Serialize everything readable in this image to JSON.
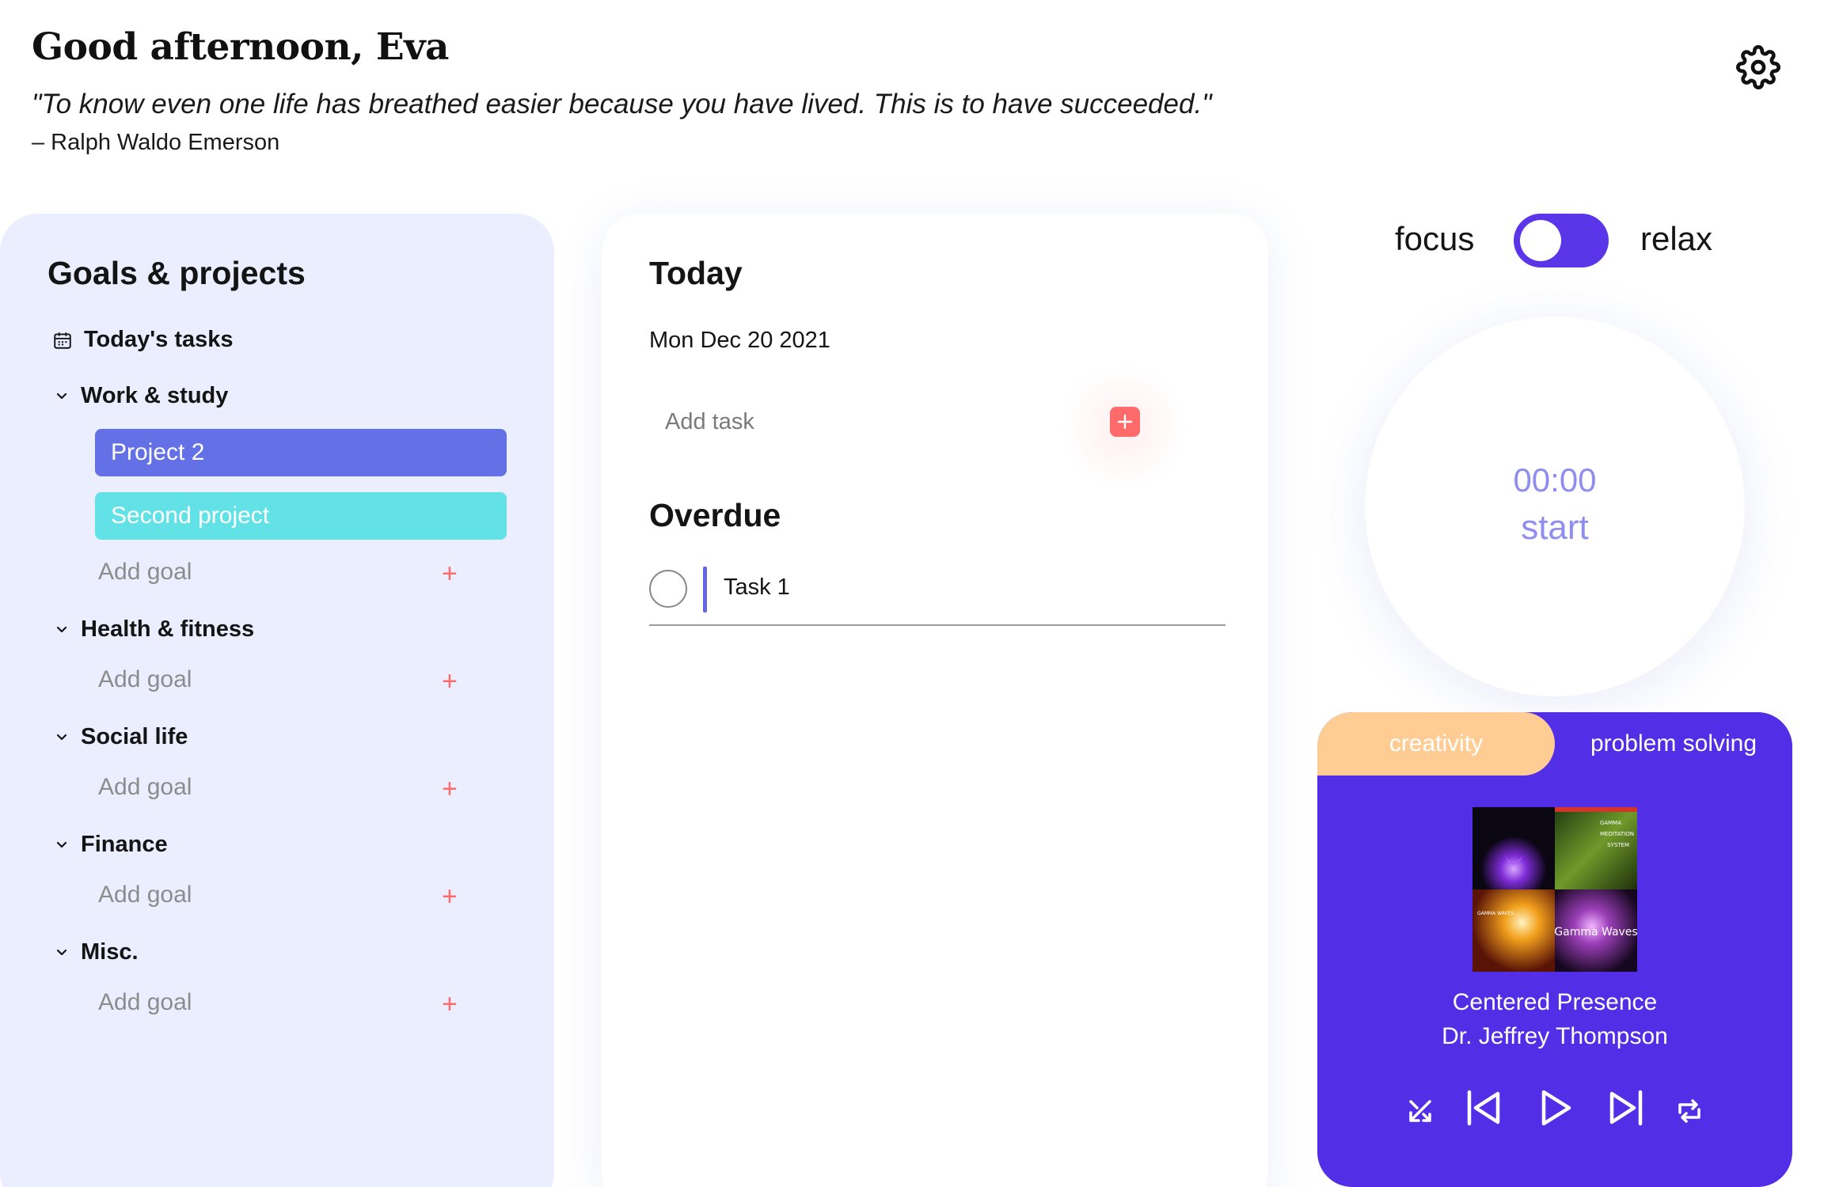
{
  "header": {
    "greeting": "Good afternoon, Eva",
    "quote": "\"To know even one life has breathed easier because you have lived. This is to have succeeded.\"",
    "quote_author": "– Ralph Waldo Emerson",
    "settings_icon": "gear-icon"
  },
  "sidebar": {
    "title": "Goals & projects",
    "todays_tasks_label": "Today's tasks",
    "add_goal_label": "Add goal",
    "categories": [
      {
        "label": "Work & study",
        "projects": [
          "Project 2",
          "Second project"
        ]
      },
      {
        "label": "Health & fitness",
        "projects": []
      },
      {
        "label": "Social life",
        "projects": []
      },
      {
        "label": "Finance",
        "projects": []
      },
      {
        "label": "Misc.",
        "projects": []
      }
    ],
    "project_colors": [
      "#6370e6",
      "#62e2e6"
    ]
  },
  "today": {
    "title": "Today",
    "date": "Mon Dec 20 2021",
    "add_task_placeholder": "Add task",
    "overdue_title": "Overdue",
    "overdue_tasks": [
      "Task 1"
    ]
  },
  "mode": {
    "focus_label": "focus",
    "relax_label": "relax",
    "selected": "focus"
  },
  "timer": {
    "time": "00:00",
    "action": "start"
  },
  "player": {
    "tabs": [
      "creativity",
      "problem solving"
    ],
    "active_tab": "problem solving",
    "track_title": "Centered Presence",
    "track_artist": "Dr. Jeffrey Thompson",
    "album_covers": [
      {
        "text": ""
      },
      {
        "text": "GAMMA MEDITATION SYSTEM"
      },
      {
        "text": "GAMMA WAVES"
      },
      {
        "text": "Gamma Waves"
      }
    ],
    "controls": [
      "shuffle-icon",
      "previous-icon",
      "play-icon",
      "next-icon",
      "repeat-icon"
    ]
  },
  "colors": {
    "accent": "#522fe6",
    "project_primary": "#6370e6",
    "project_secondary": "#62e2e6",
    "add_red": "#ff6b6b",
    "sidebar_bg": "#ebeeff",
    "tab_creativity": "#ffcc94",
    "timer_text": "#8f8ef0"
  }
}
